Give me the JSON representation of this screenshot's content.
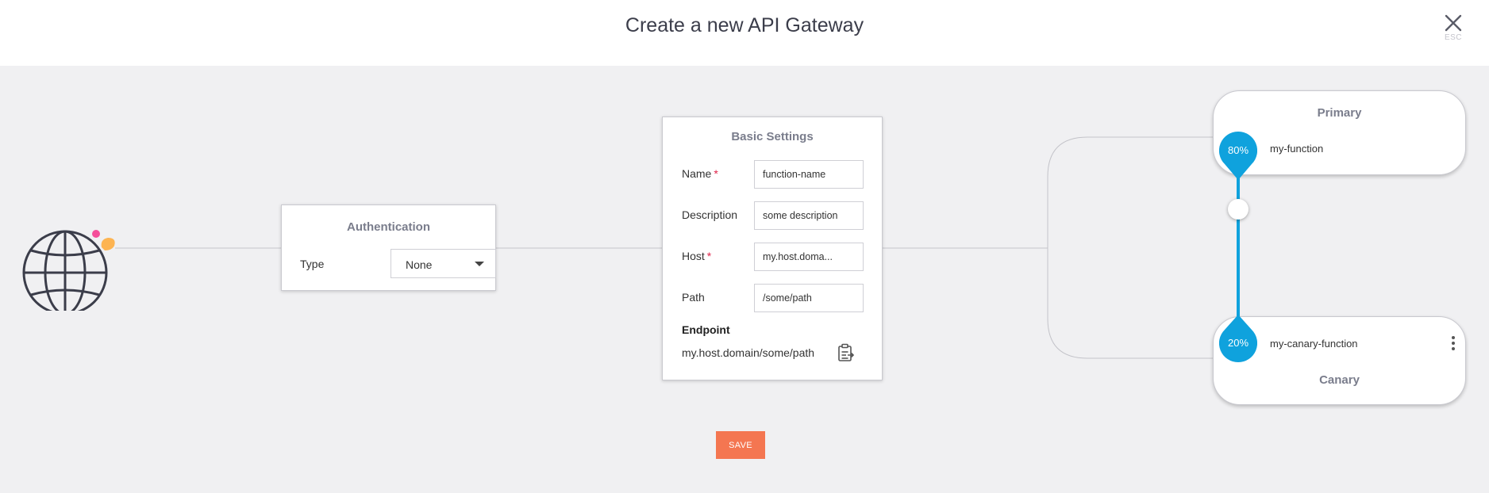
{
  "header": {
    "title": "Create a new API Gateway",
    "close_hint": "ESC"
  },
  "authentication": {
    "title": "Authentication",
    "type_label": "Type",
    "type_value": "None"
  },
  "basic_settings": {
    "title": "Basic Settings",
    "name_label": "Name",
    "name_value": "function-name",
    "description_label": "Description",
    "description_value": "some description",
    "host_label": "Host",
    "host_value": "my.host.doma...",
    "path_label": "Path",
    "path_value": "/some/path",
    "required_mark": "*",
    "endpoint_label": "Endpoint",
    "endpoint_value": "my.host.domain/some/path"
  },
  "save_label": "SAVE",
  "primary": {
    "title": "Primary",
    "function_name": "my-function",
    "percent_label": "80%",
    "percent": 80
  },
  "canary": {
    "title": "Canary",
    "function_name": "my-canary-function",
    "percent_label": "20%",
    "percent": 20
  },
  "colors": {
    "accent": "#0fa2dd",
    "save": "#f47651",
    "icon": "#3b3d4a",
    "required": "#e0244a"
  }
}
